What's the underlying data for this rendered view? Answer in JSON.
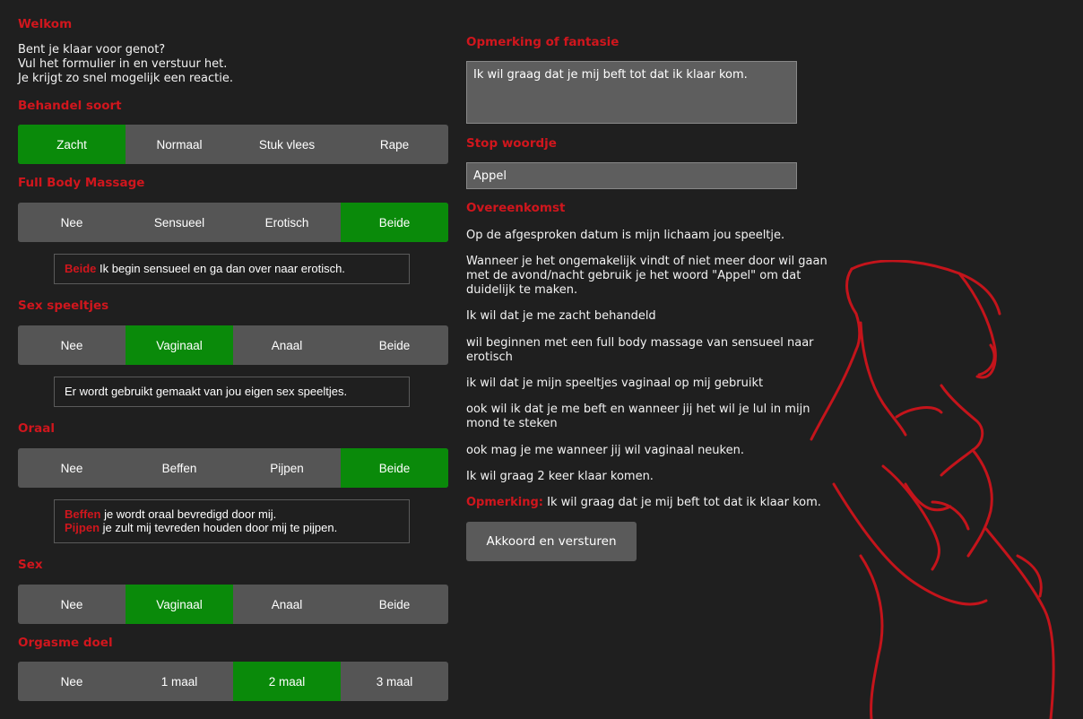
{
  "welcome": {
    "title": "Welkom",
    "text": "Bent je klaar voor genot?\nVul het formulier in en verstuur het.\nJe krijgt zo snel mogelijk een reactie."
  },
  "groups": [
    {
      "title": "Behandel soort",
      "options": [
        "Zacht",
        "Normaal",
        "Stuk vlees",
        "Rape"
      ],
      "selected": 0
    },
    {
      "title": "Full Body Massage",
      "options": [
        "Nee",
        "Sensueel",
        "Erotisch",
        "Beide"
      ],
      "selected": 3
    },
    {
      "title": "Sex speeltjes",
      "options": [
        "Nee",
        "Vaginaal",
        "Anaal",
        "Beide"
      ],
      "selected": 1
    },
    {
      "title": "Oraal",
      "options": [
        "Nee",
        "Beffen",
        "Pijpen",
        "Beide"
      ],
      "selected": 3
    },
    {
      "title": "Sex",
      "options": [
        "Nee",
        "Vaginaal",
        "Anaal",
        "Beide"
      ],
      "selected": 1
    },
    {
      "title": "Orgasme doel",
      "options": [
        "Nee",
        "1 maal",
        "2 maal",
        "3 maal"
      ],
      "selected": 2
    }
  ],
  "info": {
    "massage": {
      "key": "Beide",
      "text": " Ik begin sensueel en ga dan over naar erotisch."
    },
    "toys": {
      "text": "Er wordt gebruikt gemaakt van jou eigen sex speeltjes."
    },
    "oral": [
      {
        "key": "Beffen",
        "text": " je wordt oraal bevredigd door mij."
      },
      {
        "key": "Pijpen",
        "text": " je zult mij tevreden houden door mij te pijpen."
      }
    ]
  },
  "remark": {
    "label": "Opmerking of fantasie",
    "value": "Ik wil graag dat je mij beft tot dat ik klaar kom."
  },
  "safeword": {
    "label": "Stop woordje",
    "value": "Appel"
  },
  "agreement": {
    "title": "Overeenkomst",
    "lines": [
      "Op de afgesproken datum is mijn lichaam jou speeltje.",
      "Wanneer je het ongemakelijk vindt of niet meer door wil gaan met de avond/nacht gebruik je het woord \"Appel\" om dat duidelijk te maken.",
      "Ik wil dat je me zacht behandeld",
      "wil beginnen met een full body massage van sensueel naar erotisch",
      "ik wil dat je mijn speeltjes vaginaal op mij gebruikt",
      "ook wil ik dat je me beft en wanneer jij het wil je lul in mijn mond te steken",
      "ook mag je me wanneer jij wil vaginaal neuken.",
      "Ik wil graag 2 keer klaar komen."
    ],
    "remark_key": "Opmerking:",
    "remark_text": " Ik wil graag dat je mij beft tot dat ik klaar kom."
  },
  "submit_label": "Akkoord en versturen",
  "colors": {
    "accent": "#d0161d",
    "selected": "#0a8a0a",
    "background": "#1f1f1f"
  }
}
